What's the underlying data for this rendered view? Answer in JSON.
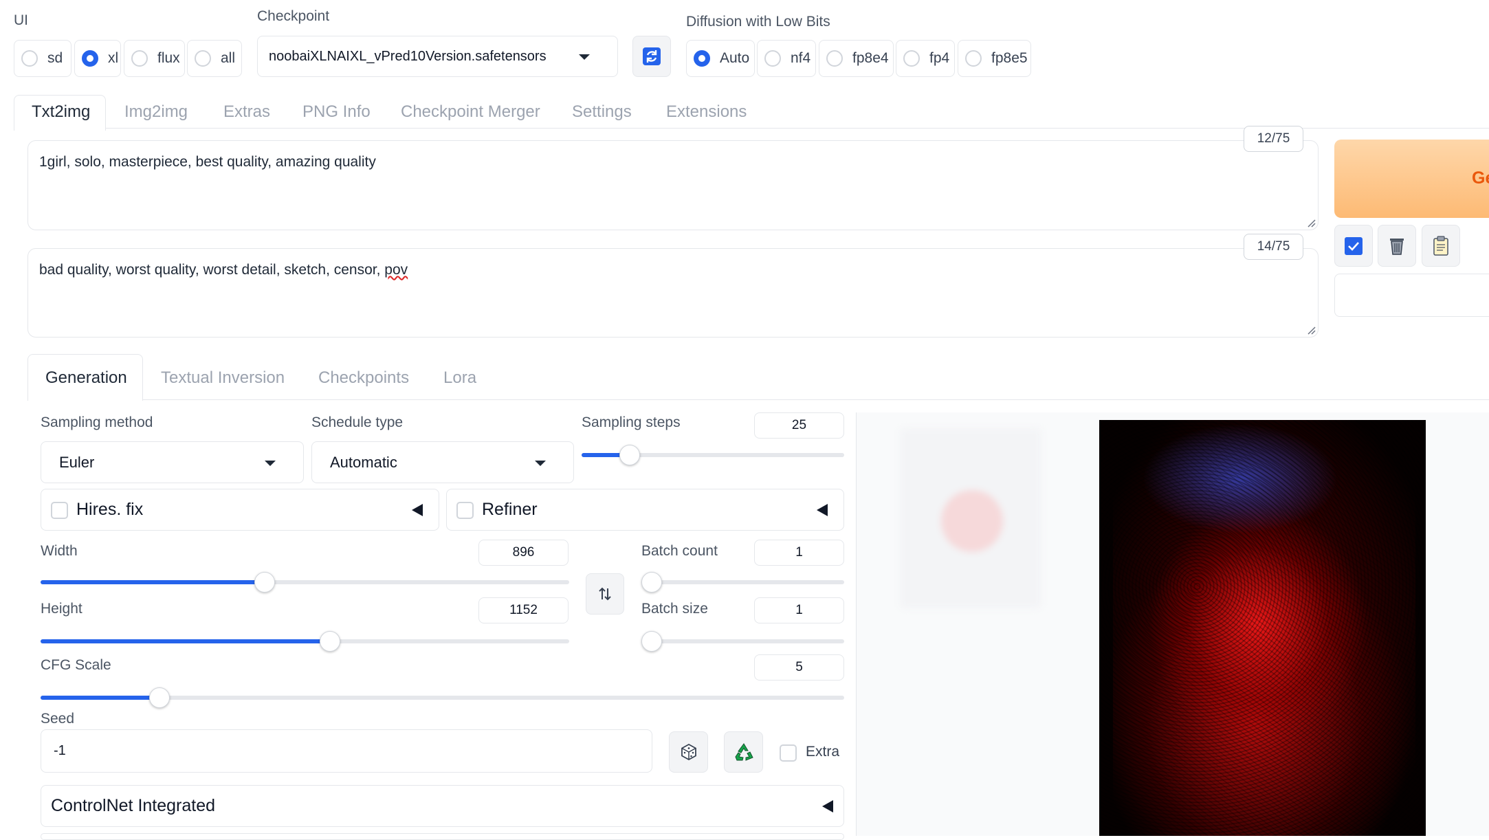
{
  "ui_selector": {
    "label": "UI",
    "options": [
      "sd",
      "xl",
      "flux",
      "all"
    ],
    "selected": "xl"
  },
  "checkpoint": {
    "label": "Checkpoint",
    "value": "noobaiXLNAIXL_vPred10Version.safetensors"
  },
  "low_bits": {
    "label": "Diffusion with Low Bits",
    "options": [
      "Auto",
      "nf4",
      "fp8e4",
      "fp4",
      "fp8e5"
    ],
    "selected": "Auto"
  },
  "main_tabs": [
    "Txt2img",
    "Img2img",
    "Extras",
    "PNG Info",
    "Checkpoint Merger",
    "Settings",
    "Extensions"
  ],
  "prompt": {
    "text": "1girl, solo, masterpiece, best quality, amazing quality",
    "token_count": "12/75"
  },
  "negative_prompt": {
    "text_before": "bad quality, worst quality, worst detail, sketch, censor, ",
    "misspelled_word": "pov",
    "token_count": "14/75"
  },
  "generate_label": "Ge",
  "sub_tabs": [
    "Generation",
    "Textual Inversion",
    "Checkpoints",
    "Lora"
  ],
  "sampling": {
    "method_label": "Sampling method",
    "method": "Euler",
    "schedule_label": "Schedule type",
    "schedule": "Automatic",
    "steps_label": "Sampling steps",
    "steps": "25",
    "steps_fraction": 0.16
  },
  "hires_fix": {
    "label": "Hires. fix",
    "checked": false
  },
  "refiner": {
    "label": "Refiner",
    "checked": false
  },
  "width": {
    "label": "Width",
    "value": "896",
    "fraction": 0.42
  },
  "height": {
    "label": "Height",
    "value": "1152",
    "fraction": 0.54
  },
  "batch_count": {
    "label": "Batch count",
    "value": "1",
    "fraction": 0.0
  },
  "batch_size": {
    "label": "Batch size",
    "value": "1",
    "fraction": 0.0
  },
  "cfg_scale": {
    "label": "CFG Scale",
    "value": "5",
    "fraction": 0.148
  },
  "seed": {
    "label": "Seed",
    "value": "-1",
    "extra_label": "Extra"
  },
  "controlnet": {
    "label": "ControlNet Integrated"
  },
  "colors": {
    "accent": "#2563eb",
    "generate_gradient_start": "#fed7aa",
    "generate_text": "#ea580c"
  },
  "icons": [
    "refresh-icon",
    "swap-dimensions-icon",
    "dice-icon",
    "recycle-icon",
    "checkbox-icon",
    "trash-icon",
    "clipboard-icon"
  ]
}
